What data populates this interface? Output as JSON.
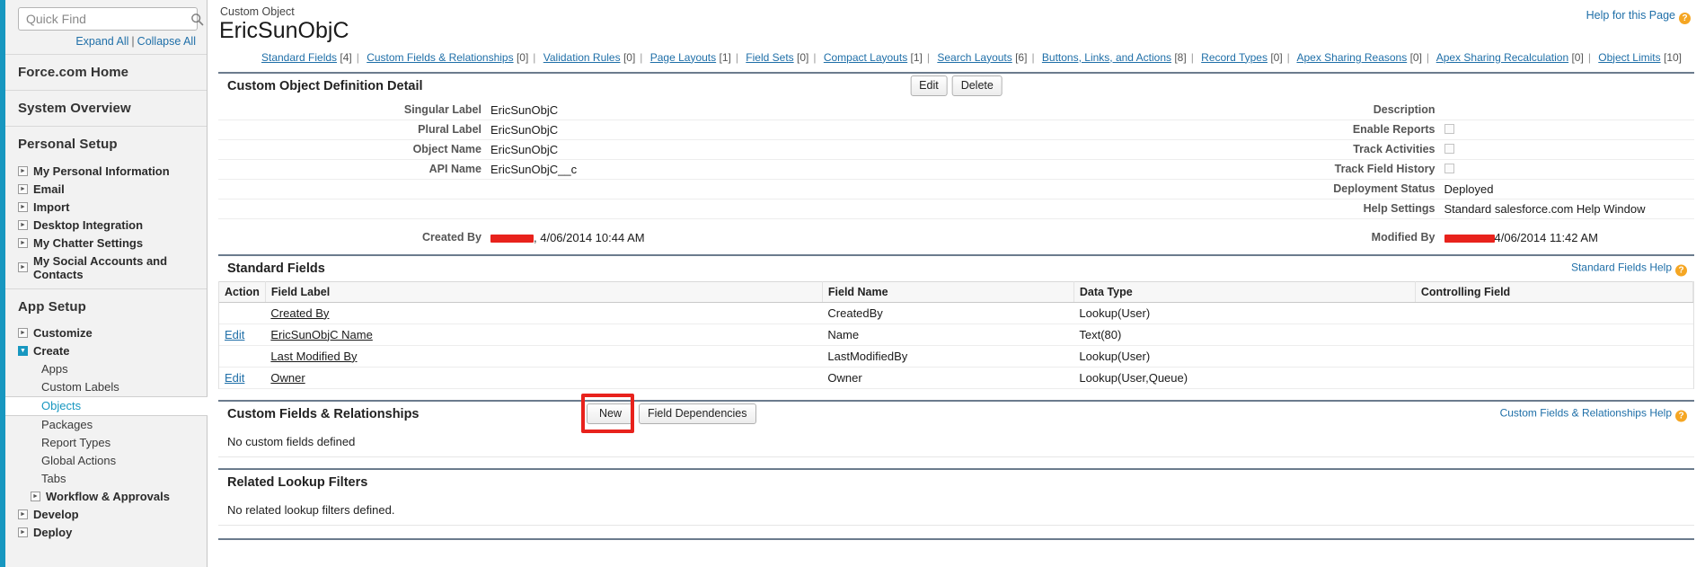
{
  "accent_color": "#1797c0",
  "highlight_color": "#e8221c",
  "sidebar": {
    "quick_find": {
      "placeholder": "Quick Find",
      "value": "",
      "icon": "search-icon"
    },
    "expand_all": "Expand All",
    "collapse_all": "Collapse All",
    "separator": "|",
    "sections": [
      {
        "header": "Force.com Home",
        "items": []
      },
      {
        "header": "System Overview",
        "items": []
      },
      {
        "header": "Personal Setup",
        "items": [
          {
            "label": "My Personal Information",
            "type": "node",
            "expanded": false
          },
          {
            "label": "Email",
            "type": "node",
            "expanded": false
          },
          {
            "label": "Import",
            "type": "node",
            "expanded": false
          },
          {
            "label": "Desktop Integration",
            "type": "node",
            "expanded": false
          },
          {
            "label": "My Chatter Settings",
            "type": "node",
            "expanded": false
          },
          {
            "label": "My Social Accounts and Contacts",
            "type": "node",
            "expanded": false
          }
        ]
      },
      {
        "header": "App Setup",
        "items": [
          {
            "label": "Customize",
            "type": "node",
            "expanded": false
          },
          {
            "label": "Create",
            "type": "node",
            "expanded": true
          },
          {
            "label": "Apps",
            "type": "leaf",
            "active": false
          },
          {
            "label": "Custom Labels",
            "type": "leaf",
            "active": false
          },
          {
            "label": "Objects",
            "type": "leaf",
            "active": true
          },
          {
            "label": "Packages",
            "type": "leaf",
            "active": false
          },
          {
            "label": "Report Types",
            "type": "leaf",
            "active": false
          },
          {
            "label": "Global Actions",
            "type": "leaf",
            "active": false
          },
          {
            "label": "Tabs",
            "type": "leaf",
            "active": false
          },
          {
            "label": "Workflow & Approvals",
            "type": "subnode",
            "expanded": false
          },
          {
            "label": "Develop",
            "type": "node",
            "expanded": false
          },
          {
            "label": "Deploy",
            "type": "node",
            "expanded": false
          }
        ]
      }
    ]
  },
  "header": {
    "eyebrow": "Custom Object",
    "title": "EricSunObjC",
    "help_link": "Help for this Page",
    "help_icon": "help-question-icon"
  },
  "nav_links": [
    {
      "label": "Standard Fields",
      "count": "[4]"
    },
    {
      "label": "Custom Fields & Relationships",
      "count": "[0]"
    },
    {
      "label": "Validation Rules",
      "count": "[0]"
    },
    {
      "label": "Page Layouts",
      "count": "[1]"
    },
    {
      "label": "Field Sets",
      "count": "[0]"
    },
    {
      "label": "Compact Layouts",
      "count": "[1]"
    },
    {
      "label": "Search Layouts",
      "count": "[6]"
    },
    {
      "label": "Buttons, Links, and Actions",
      "count": "[8]"
    },
    {
      "label": "Record Types",
      "count": "[0]"
    },
    {
      "label": "Apex Sharing Reasons",
      "count": "[0]"
    },
    {
      "label": "Apex Sharing Recalculation",
      "count": "[0]"
    },
    {
      "label": "Object Limits",
      "count": "[10]"
    }
  ],
  "definition_detail": {
    "title": "Custom Object Definition Detail",
    "edit_label": "Edit",
    "delete_label": "Delete",
    "left": [
      {
        "label": "Singular Label",
        "value": "EricSunObjC"
      },
      {
        "label": "Plural Label",
        "value": "EricSunObjC"
      },
      {
        "label": "Object Name",
        "value": "EricSunObjC"
      },
      {
        "label": "API Name",
        "value": "EricSunObjC__c"
      }
    ],
    "right": [
      {
        "label": "Description",
        "value": ""
      },
      {
        "label": "Enable Reports",
        "value": "",
        "checkbox": true,
        "checked": false
      },
      {
        "label": "Track Activities",
        "value": "",
        "checkbox": true,
        "checked": false
      },
      {
        "label": "Track Field History",
        "value": "",
        "checkbox": true,
        "checked": false
      },
      {
        "label": "Deployment Status",
        "value": "Deployed"
      },
      {
        "label": "Help Settings",
        "value": "Standard salesforce.com Help Window"
      }
    ],
    "created_by": {
      "label": "Created By",
      "user": "[redacted]",
      "value": ", 4/06/2014 10:44 AM"
    },
    "modified_by": {
      "label": "Modified By",
      "user": "[redacted]",
      "value": "4/06/2014 11:42 AM"
    }
  },
  "standard_fields": {
    "title": "Standard Fields",
    "help_link": "Standard Fields Help",
    "help_icon": "help-question-icon",
    "columns": [
      "Action",
      "Field Label",
      "Field Name",
      "Data Type",
      "Controlling Field"
    ],
    "rows": [
      {
        "action": "",
        "field_label": "Created By",
        "field_name": "CreatedBy",
        "data_type": "Lookup(User)",
        "controlling_field": ""
      },
      {
        "action": "Edit",
        "field_label": "EricSunObjC Name",
        "field_name": "Name",
        "data_type": "Text(80)",
        "controlling_field": ""
      },
      {
        "action": "",
        "field_label": "Last Modified By",
        "field_name": "LastModifiedBy",
        "data_type": "Lookup(User)",
        "controlling_field": ""
      },
      {
        "action": "Edit",
        "field_label": "Owner",
        "field_name": "Owner",
        "data_type": "Lookup(User,Queue)",
        "controlling_field": ""
      }
    ]
  },
  "custom_fields": {
    "title": "Custom Fields & Relationships",
    "new_label": "New",
    "field_dependencies_label": "Field Dependencies",
    "help_link": "Custom Fields & Relationships Help",
    "help_icon": "help-question-icon",
    "empty_message": "No custom fields defined"
  },
  "related_lookup_filters": {
    "title": "Related Lookup Filters",
    "empty_message": "No related lookup filters defined."
  }
}
